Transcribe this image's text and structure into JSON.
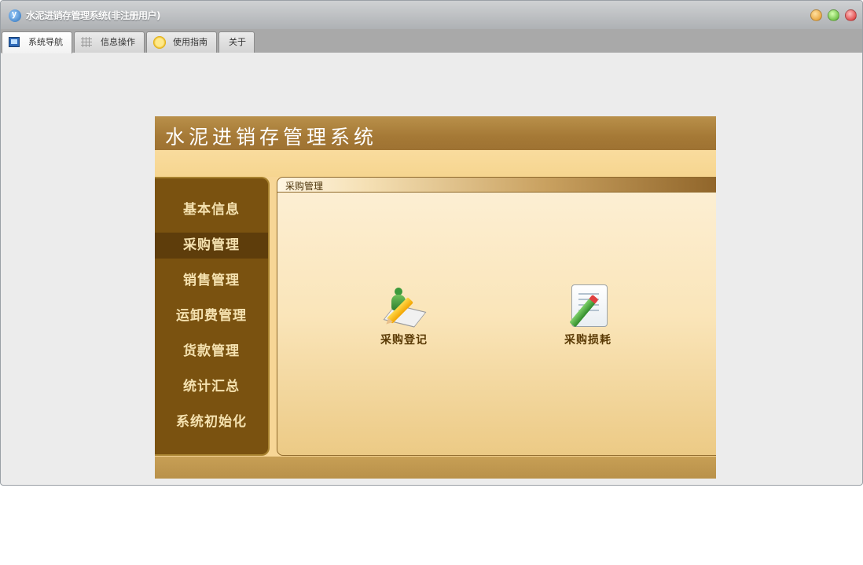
{
  "window": {
    "title": "水泥进销存管理系统(非注册用户)",
    "controls": [
      "minimize-button",
      "maximize-button",
      "close-button"
    ]
  },
  "tabs": [
    {
      "label": "系统导航",
      "icon": "monitor-icon",
      "active": true
    },
    {
      "label": "信息操作",
      "icon": "grid-icon",
      "active": false
    },
    {
      "label": "使用指南",
      "icon": "clock-icon",
      "active": false
    },
    {
      "label": "关于",
      "icon": "",
      "active": false
    }
  ],
  "banner": {
    "title": "水泥进销存管理系统"
  },
  "sidebar": {
    "items": [
      {
        "label": "基本信息"
      },
      {
        "label": "采购管理",
        "active": true
      },
      {
        "label": "销售管理"
      },
      {
        "label": "运卸费管理"
      },
      {
        "label": "货款管理"
      },
      {
        "label": "统计汇总"
      },
      {
        "label": "系统初始化"
      }
    ]
  },
  "panel": {
    "title": "采购管理",
    "functions": [
      {
        "label": "采购登记",
        "icon": "register-pencil-icon"
      },
      {
        "label": "采购损耗",
        "icon": "document-pencil-icon"
      }
    ]
  },
  "colors": {
    "banner": "#a57936",
    "sidebar": "#7a5210",
    "sidebar_active": "#5e3d0b",
    "panel_bg": "#fae5b9"
  }
}
